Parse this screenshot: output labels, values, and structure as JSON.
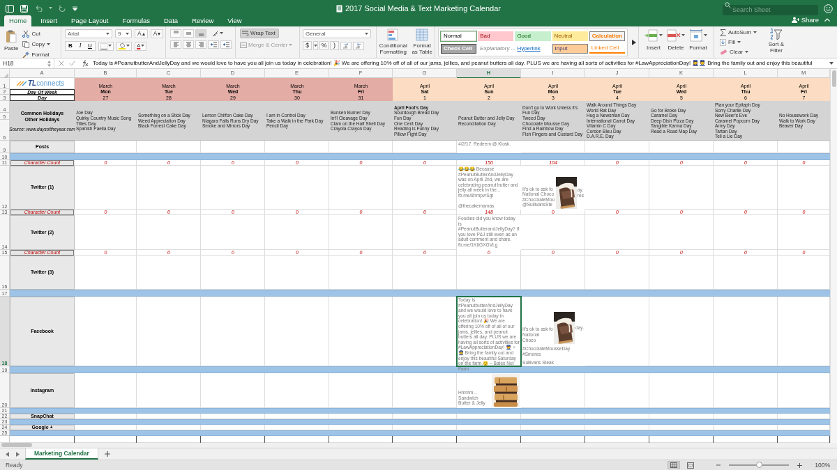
{
  "window": {
    "title": "2017 Social Media & Text Marketing Calendar",
    "search": {
      "placeholder": "Search Sheet"
    },
    "share": "Share"
  },
  "ribbon_tabs": [
    {
      "label": "Home",
      "selected": true
    },
    {
      "label": "Insert",
      "selected": false
    },
    {
      "label": "Page Layout",
      "selected": false
    },
    {
      "label": "Formulas",
      "selected": false
    },
    {
      "label": "Data",
      "selected": false
    },
    {
      "label": "Review",
      "selected": false
    },
    {
      "label": "View",
      "selected": false
    }
  ],
  "ribbon": {
    "clipboard": {
      "paste": "Paste",
      "cut": "Cut",
      "copy": "Copy",
      "format": "Format"
    },
    "font": {
      "name": "Arial",
      "size": "9",
      "grow": "A",
      "shrink": "A",
      "bold": "B",
      "italic": "I",
      "underline": "U",
      "font_color_button": "A"
    },
    "alignment": {
      "wrap_text": "Wrap Text",
      "wrap_on": true,
      "merge": "Merge & Center"
    },
    "number": {
      "format": "General",
      "currency": "$",
      "percent": "%",
      "comma": ")"
    },
    "conditional_formatting": "Conditional Formatting",
    "format_as_table": "Format as Table",
    "styles": [
      {
        "label": "Normal",
        "kind": "normal",
        "selected": true
      },
      {
        "label": "Bad",
        "kind": "bad",
        "selected": false
      },
      {
        "label": "Good",
        "kind": "good",
        "selected": false
      },
      {
        "label": "Neutral",
        "kind": "neutral",
        "selected": false
      },
      {
        "label": "Calculation",
        "kind": "calculation",
        "selected": false
      },
      {
        "label": "Check Cell",
        "kind": "check",
        "selected": false
      },
      {
        "label": "Explanatory ...",
        "kind": "explanatory",
        "selected": false
      },
      {
        "label": "Hyperlink",
        "kind": "hyperlink",
        "selected": false
      },
      {
        "label": "Input",
        "kind": "input",
        "selected": false
      },
      {
        "label": "Linked Cell",
        "kind": "linked",
        "selected": false
      }
    ],
    "cells": [
      "Insert",
      "Delete",
      "Format"
    ],
    "editing": {
      "autosum": "AutoSum",
      "fill": "Fill",
      "clear": "Clear",
      "sort_filter": "Sort & Filter"
    }
  },
  "formula_bar": {
    "cell_ref": "H18",
    "content": "Today is #PeanutbutterAndJellyDay and we would love to have you all join us today in celebration! 🎉 We are offering 10% off of all of our jams, jellies, and peanut butters all day. PLUS we are having all sorts of activities for #LawAppreciationDay! 👮‍♀️👮 Bring the family out and enjoy this beautiful"
  },
  "columns": [
    {
      "label": "A",
      "selected": false
    },
    {
      "label": "B",
      "selected": false
    },
    {
      "label": "C",
      "selected": false
    },
    {
      "label": "D",
      "selected": false
    },
    {
      "label": "E",
      "selected": false
    },
    {
      "label": "F",
      "selected": false
    },
    {
      "label": "G",
      "selected": false
    },
    {
      "label": "H",
      "selected": true
    },
    {
      "label": "I",
      "selected": false
    },
    {
      "label": "J",
      "selected": false
    },
    {
      "label": "K",
      "selected": false
    },
    {
      "label": "L",
      "selected": false
    },
    {
      "label": "M",
      "selected": false
    }
  ],
  "row_numbers": [
    {
      "label": "1",
      "selected": false
    },
    {
      "label": "2",
      "selected": false
    },
    {
      "label": "3",
      "selected": false
    },
    {
      "label": "4",
      "selected": false
    },
    {
      "label": "5",
      "selected": false
    },
    {
      "label": "6",
      "selected": false
    },
    {
      "label": "9",
      "selected": false
    },
    {
      "label": "10",
      "selected": false
    },
    {
      "label": "11",
      "selected": false
    },
    {
      "label": "12",
      "selected": false
    },
    {
      "label": "13",
      "selected": false
    },
    {
      "label": "14",
      "selected": false
    },
    {
      "label": "15",
      "selected": false
    },
    {
      "label": "16",
      "selected": false
    },
    {
      "label": "17",
      "selected": false
    },
    {
      "label": "18",
      "selected": true
    },
    {
      "label": "19",
      "selected": false
    },
    {
      "label": "20",
      "selected": false
    },
    {
      "label": "21",
      "selected": false
    },
    {
      "label": "22",
      "selected": false
    },
    {
      "label": "23",
      "selected": false
    },
    {
      "label": "24",
      "selected": false
    },
    {
      "label": "25",
      "selected": false
    }
  ],
  "sheet": {
    "logo": {
      "mark": "TL",
      "word": "connects"
    },
    "day_of_week_label": "Day Of Week",
    "day_label": "Day",
    "holiday_labels": [
      "Common Holidays",
      "Other Holidays"
    ],
    "source": "Source: www.daysoftheyear.com",
    "days": [
      {
        "month": "March",
        "weekday": "Mon",
        "day": "27",
        "color": "#e3aca5",
        "holidays": [
          "Joe Day",
          "Quirky Country Music Song Titles Day",
          "Spanish Paella Day"
        ]
      },
      {
        "month": "March",
        "weekday": "Tue",
        "day": "28",
        "color": "#e3aca5",
        "holidays": [
          "Something on a Stick Day",
          "Weed Appreciation Day",
          "Black Forrest Cake Day"
        ]
      },
      {
        "month": "March",
        "weekday": "Wed",
        "day": "29",
        "color": "#e3aca5",
        "holidays": [
          "Lemon Chiffon Cake Day",
          "Niagara Falls Runs Dry Day",
          "Smoke and Mirrors Day"
        ]
      },
      {
        "month": "March",
        "weekday": "Thu",
        "day": "30",
        "color": "#e3aca5",
        "holidays": [
          "I am in Control Day",
          "Take a Walk in the Park Day",
          "Pencil Day"
        ]
      },
      {
        "month": "March",
        "weekday": "Fri",
        "day": "31",
        "color": "#e3aca5",
        "holidays": [
          "Bunsen Burner Day",
          "Int'l Cleavage Day",
          "Clam on the Half Shell Day",
          "Crayola Crayon Day"
        ]
      },
      {
        "month": "April",
        "weekday": "Sat",
        "day": "1",
        "color": "#fcdcc2",
        "holidays": [
          "**April Fool's Day**",
          "Sourdough Bread Day",
          "Fun Day",
          "One Cent Day",
          "Reading is Funny Day",
          "Pillow Fight Day"
        ]
      },
      {
        "month": "April",
        "weekday": "Sun",
        "day": "2",
        "color": "#fcdcc2",
        "holidays": [
          "Peanut Butter and Jelly Day",
          "Reconciliation Day"
        ]
      },
      {
        "month": "April",
        "weekday": "Mon",
        "day": "3",
        "color": "#fcdcc2",
        "holidays": [
          "Don't go to Work Unless it's Fun Day",
          "Tweed Day",
          "Chocolate Mousse Day",
          "Find a Rainbow Day",
          "Fish Fingers and Custard Day"
        ]
      },
      {
        "month": "April",
        "weekday": "Tue",
        "day": "4",
        "color": "#fcdcc2",
        "holidays": [
          "Walk Around Things Day",
          "World Rat Day",
          "Hug a Newsman Day",
          "International Carrot Day",
          "Vitamin C Day",
          "Cordon Bleu Day",
          "D.A.R.E. Day"
        ]
      },
      {
        "month": "April",
        "weekday": "Wed",
        "day": "5",
        "color": "#fcdcc2",
        "holidays": [
          "Go for Broke Day",
          "Caramel Day",
          "Deep Dish Pizza Day",
          "Tangible Karma Day",
          "Read a Road Map Day"
        ]
      },
      {
        "month": "April",
        "weekday": "Thu",
        "day": "6",
        "color": "#fcdcc2",
        "holidays": [
          "Plan your Epitaph Day",
          "Sorry Charlie Day",
          "New Beer's Eve",
          "Caramel Popcorn Day",
          "Army Day",
          "Tartan Day",
          "Tell a Lie Day"
        ]
      },
      {
        "month": "April",
        "weekday": "Fri",
        "day": "7",
        "color": "#fcdcc2",
        "holidays": [
          "No Housework Day",
          "Walk to Work Day",
          "Beaver Day"
        ]
      }
    ],
    "channels": [
      {
        "label": "Posts",
        "divider_after": true,
        "cells": [
          {
            "kind": "empty"
          },
          {
            "kind": "empty"
          },
          {
            "kind": "empty"
          },
          {
            "kind": "empty"
          },
          {
            "kind": "empty"
          },
          {
            "kind": "empty"
          },
          {
            "kind": "text",
            "selected": false,
            "paragraphs": [
              "4/2/17. Redeem @ Kiosk."
            ]
          },
          {
            "kind": "empty"
          },
          {
            "kind": "empty"
          },
          {
            "kind": "empty"
          },
          {
            "kind": "empty"
          },
          {
            "kind": "empty"
          }
        ]
      },
      {
        "label": "Twitter (1)",
        "divider_after": false,
        "count_label": "Character Count",
        "cells": [
          {
            "kind": "empty",
            "count": "0"
          },
          {
            "kind": "empty",
            "count": "0"
          },
          {
            "kind": "empty",
            "count": "0"
          },
          {
            "kind": "empty",
            "count": "0"
          },
          {
            "kind": "empty",
            "count": "0"
          },
          {
            "kind": "empty",
            "count": "0"
          },
          {
            "kind": "text",
            "count": "150",
            "selected": false,
            "paragraphs": [
              "😂😂😂 Because #PeanutButterAndJellyDay was on April 2nd, we are celebrating peanut butter and jelly all week in the... fb.me/8hmpvrSgt",
              "@thecakemamas"
            ]
          },
          {
            "kind": "picture",
            "count": "104",
            "selected": false,
            "beside": [
              "It's ok to ask fo",
              "National Choco",
              "#ChocolateMou",
              "@SullivansSte"
            ],
            "tail": [
              "ay.",
              "res"
            ]
          },
          {
            "kind": "empty",
            "count": "0"
          },
          {
            "kind": "empty",
            "count": "0"
          },
          {
            "kind": "empty",
            "count": "0"
          },
          {
            "kind": "empty",
            "count": "0"
          }
        ]
      },
      {
        "label": "Twitter (2)",
        "divider_after": false,
        "count_label": "Character Count",
        "cells": [
          {
            "kind": "empty",
            "count": "0"
          },
          {
            "kind": "empty",
            "count": "0"
          },
          {
            "kind": "empty",
            "count": "0"
          },
          {
            "kind": "empty",
            "count": "0"
          },
          {
            "kind": "empty",
            "count": "0"
          },
          {
            "kind": "empty",
            "count": "0"
          },
          {
            "kind": "text",
            "count": "148",
            "selected": false,
            "paragraphs": [
              "Foodies did you know today is #PeanutButterandJellyDay?  If you love P&J still even as an adult comment and share. fb.me/1K6GXGVLg"
            ]
          },
          {
            "kind": "empty",
            "count": "0"
          },
          {
            "kind": "empty",
            "count": "0"
          },
          {
            "kind": "empty",
            "count": "0"
          },
          {
            "kind": "empty",
            "count": "0"
          },
          {
            "kind": "empty",
            "count": "0"
          }
        ]
      },
      {
        "label": "Twitter (3)",
        "divider_after": true,
        "count_label": "Character Count",
        "cells": [
          {
            "kind": "empty",
            "count": "0"
          },
          {
            "kind": "empty",
            "count": "0"
          },
          {
            "kind": "empty",
            "count": "0"
          },
          {
            "kind": "empty",
            "count": "0"
          },
          {
            "kind": "empty",
            "count": "0"
          },
          {
            "kind": "empty",
            "count": "0"
          },
          {
            "kind": "empty",
            "count": "0"
          },
          {
            "kind": "empty",
            "count": "0"
          },
          {
            "kind": "empty",
            "count": "0"
          },
          {
            "kind": "empty",
            "count": "0"
          },
          {
            "kind": "empty",
            "count": "0"
          },
          {
            "kind": "empty",
            "count": "0"
          }
        ]
      },
      {
        "label": "Facebook",
        "divider_after": true,
        "cells": [
          {
            "kind": "empty"
          },
          {
            "kind": "empty"
          },
          {
            "kind": "empty"
          },
          {
            "kind": "empty"
          },
          {
            "kind": "empty"
          },
          {
            "kind": "empty"
          },
          {
            "kind": "text",
            "selected": true,
            "paragraphs": [
              "Today is #PeanutbutterAndJellyDay and we would love to have you all join us today in celebration! 🎉 We are offering 10% off of all of our jams, jellies, and peanut butters all day. PLUS we are having all sorts of activities for #LawAppreciationDay! 👮 ♀ 👮 Bring the family out and enjoy this beautiful Saturday on the farm.😊  – Bates Nut Farm"
            ]
          },
          {
            "kind": "picture",
            "selected": false,
            "beside": [
              "It's ok to ask fo",
              "National Choco"
            ],
            "tail": [
              "day."
            ],
            "below": [
              "#ChocolateMousseDay #Smores",
              "Sullivans Steak"
            ]
          },
          {
            "kind": "empty"
          },
          {
            "kind": "empty"
          },
          {
            "kind": "empty"
          },
          {
            "kind": "empty"
          }
        ]
      },
      {
        "label": "Instagram",
        "divider_after": true,
        "cells": [
          {
            "kind": "empty"
          },
          {
            "kind": "empty"
          },
          {
            "kind": "empty"
          },
          {
            "kind": "empty"
          },
          {
            "kind": "empty"
          },
          {
            "kind": "empty"
          },
          {
            "kind": "picture",
            "selected": false,
            "beside": [
              "Hmmm...",
              "Sandwich",
              "Butter & Jelly"
            ]
          },
          {
            "kind": "empty"
          },
          {
            "kind": "empty"
          },
          {
            "kind": "empty"
          },
          {
            "kind": "empty"
          },
          {
            "kind": "empty"
          }
        ]
      },
      {
        "label": "SnapChat",
        "divider_after": true
      },
      {
        "label": "Google +",
        "divider_after": true
      }
    ]
  },
  "sheet_tabs": [
    {
      "label": "Marketing Calendar",
      "selected": true
    }
  ],
  "status_bar": {
    "status": "Ready",
    "zoom": "100%",
    "zoom_slider": {
      "level": 0.5
    }
  }
}
